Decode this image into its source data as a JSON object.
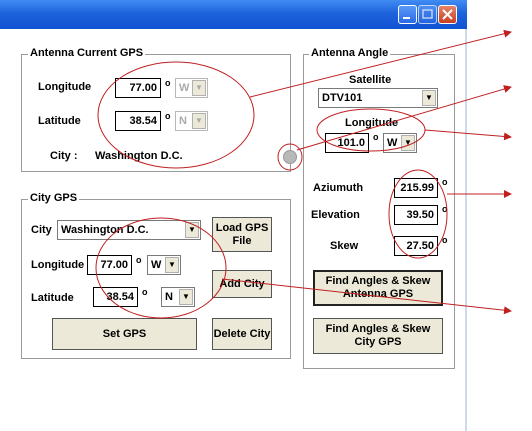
{
  "window": {
    "min_icon": "minimize-icon",
    "max_icon": "maximize-icon",
    "close_icon": "close-icon"
  },
  "antenna_gps": {
    "title": "Antenna Current GPS",
    "longitude_label": "Longitude",
    "longitude_value": "77.00",
    "longitude_dir": "W",
    "latitude_label": "Latitude",
    "latitude_value": "38.54",
    "latitude_dir": "N",
    "city_label": "City :",
    "city_value": "Washington D.C.",
    "degree": "o"
  },
  "city_gps": {
    "title": "City GPS",
    "city_label": "City",
    "city_value": "Washington D.C.",
    "longitude_label": "Longitude",
    "longitude_value": "77.00",
    "longitude_dir": "W",
    "latitude_label": "Latitude",
    "latitude_value": "38.54",
    "latitude_dir": "N",
    "load_gps_label": "Load GPS File",
    "add_city_label": "Add City",
    "set_gps_label": "Set GPS",
    "delete_city_label": "Delete City",
    "degree": "o"
  },
  "antenna_angle": {
    "title": "Antenna Angle",
    "satellite_label": "Satellite",
    "satellite_value": "DTV101",
    "longitude_label": "Longitude",
    "longitude_value": "101.0",
    "longitude_dir": "W",
    "azimuth_label": "Aziumuth",
    "azimuth_value": "215.99",
    "elevation_label": "Elevation",
    "elevation_value": "39.50",
    "skew_label": "Skew",
    "skew_value": "27.50",
    "find_antenna_label": "Find Angles & Skew Antenna GPS",
    "find_city_label": "Find Angles & Skew City GPS",
    "degree": "o"
  },
  "colors": {
    "titlebar": "#1e63dc",
    "annotation": "#c02020",
    "button": "#ece9d8"
  }
}
